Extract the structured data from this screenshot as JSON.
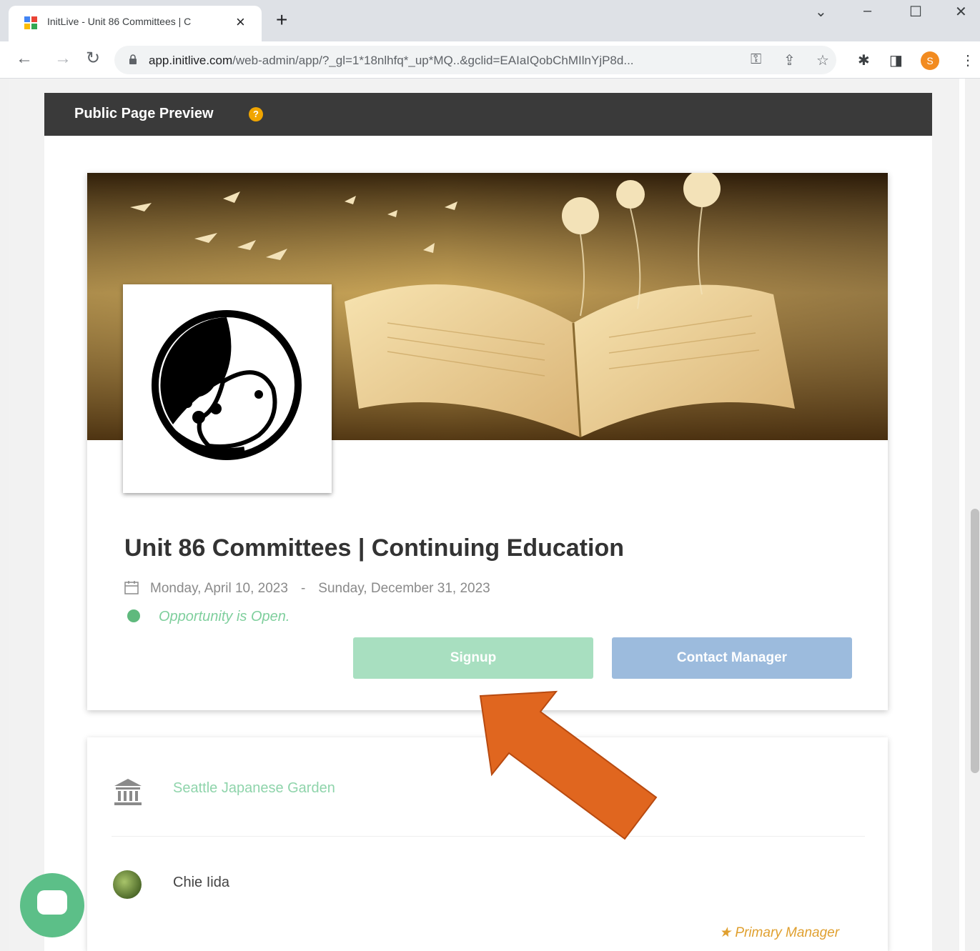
{
  "browser": {
    "tab_title": "InitLive - Unit 86 Committees | C",
    "url_host": "app.initlive.com",
    "url_path": "/web-admin/app/?_gl=1*18nlhfq*_up*MQ..&gclid=EAIaIQobChMIlnYjP8d...",
    "profile_initial": "S"
  },
  "panel": {
    "title": "Public Page Preview",
    "help_icon": "?"
  },
  "event": {
    "title": "Unit 86 Committees | Continuing Education",
    "start_date": "Monday, April 10, 2023",
    "date_separator": "-",
    "end_date": "Sunday, December 31, 2023",
    "status": "Opportunity is Open.",
    "signup_label": "Signup",
    "contact_label": "Contact Manager"
  },
  "details": {
    "location": "Seattle Japanese Garden",
    "manager_name": "Chie Iida",
    "manager_role": "Primary Manager",
    "manager_role_icon": "★"
  },
  "colors": {
    "header_bg": "#3a3a3a",
    "signup_bg": "#a8dfc0",
    "contact_bg": "#9cbbdd",
    "status_green": "#5fb97d",
    "annotation_arrow": "#e0661f"
  }
}
